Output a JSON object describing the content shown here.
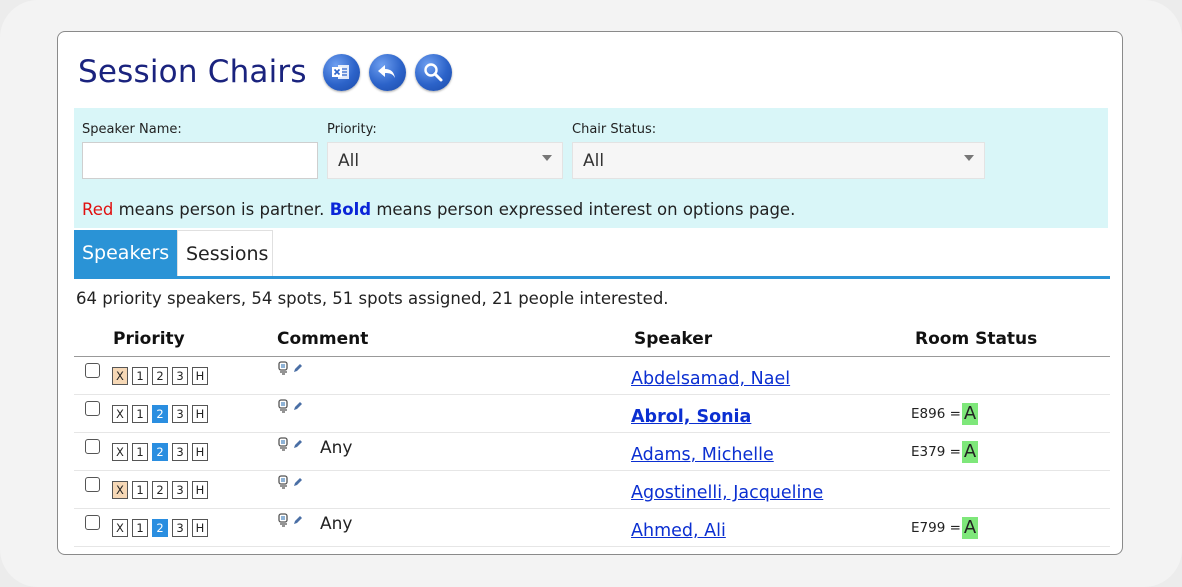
{
  "header": {
    "title": "Session Chairs"
  },
  "filters": {
    "speaker_name_label": "Speaker Name:",
    "speaker_name_value": "",
    "priority_label": "Priority:",
    "priority_value": "All",
    "chair_status_label": "Chair Status:",
    "chair_status_value": "All"
  },
  "legend": {
    "red_word": "Red",
    "red_text": " means person is partner. ",
    "bold_word": "Bold",
    "bold_text": " means person expressed interest on options page."
  },
  "tabs": [
    {
      "label": "Speakers",
      "active": true
    },
    {
      "label": "Sessions",
      "active": false
    }
  ],
  "summary": "64 priority speakers, 54 spots, 51 spots assigned, 21 people interested.",
  "columns": {
    "priority": "Priority",
    "comment": "Comment",
    "speaker": "Speaker",
    "room_status": "Room Status"
  },
  "priority_options": [
    "X",
    "1",
    "2",
    "3",
    "H"
  ],
  "rows": [
    {
      "selected_priority": "X",
      "comment": "",
      "speaker": "Abdelsamad, Nael",
      "bold": false,
      "room": "",
      "status": ""
    },
    {
      "selected_priority": "2",
      "comment": "",
      "speaker": "Abrol, Sonia",
      "bold": true,
      "room": "E896 =",
      "status": "A"
    },
    {
      "selected_priority": "2",
      "comment": "Any",
      "speaker": "Adams, Michelle",
      "bold": false,
      "room": "E379 =",
      "status": "A"
    },
    {
      "selected_priority": "X",
      "comment": "",
      "speaker": "Agostinelli, Jacqueline",
      "bold": false,
      "room": "",
      "status": ""
    },
    {
      "selected_priority": "2",
      "comment": "Any",
      "speaker": "Ahmed, Ali",
      "bold": false,
      "room": "E799 =",
      "status": "A"
    }
  ],
  "icons": {
    "excel": "excel-export-icon",
    "back": "back-arrow-icon",
    "search": "search-icon",
    "comment_view": "comment-view-icon",
    "comment_edit": "pencil-edit-icon"
  },
  "colors": {
    "title": "#1a237e",
    "filter_panel": "#d9f6f8",
    "tab_active": "#2a93d6",
    "link": "#0b2fd1",
    "partner_red": "#e01010",
    "status_green": "#7ee77a",
    "priority_x": "#f6d8b6",
    "priority_selected": "#2a8ee0"
  }
}
